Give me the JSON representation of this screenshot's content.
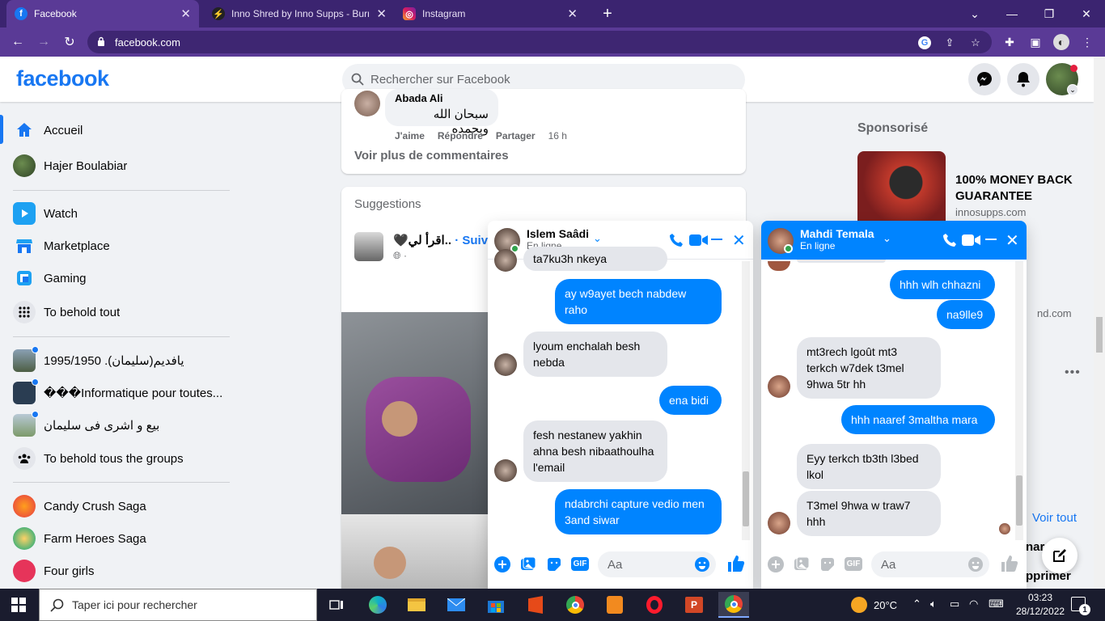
{
  "browser": {
    "tabs": [
      {
        "label": "Facebook",
        "active": true
      },
      {
        "label": "Inno Shred by Inno Supps - Burn",
        "active": false
      },
      {
        "label": "Instagram",
        "active": false
      }
    ],
    "url": "facebook.com"
  },
  "header": {
    "logo": "facebook",
    "search_placeholder": "Rechercher sur Facebook"
  },
  "sidebar": {
    "items": [
      {
        "label": "Accueil"
      },
      {
        "label": "Hajer Boulabiar"
      },
      {
        "label": "Watch"
      },
      {
        "label": "Marketplace"
      },
      {
        "label": "Gaming"
      },
      {
        "label": "To behold tout"
      },
      {
        "label": "1995/1950 .(سليمان)يافديم"
      },
      {
        "label": "���Informatique pour toutes..."
      },
      {
        "label": "بيع و اشرى فى سليمان"
      },
      {
        "label": "To behold tous the groups"
      },
      {
        "label": "Candy Crush Saga"
      },
      {
        "label": "Farm Heroes Saga"
      },
      {
        "label": "Four girls"
      }
    ]
  },
  "feed": {
    "comment_author": "Abada Ali",
    "comment_text": "سبحان الله وبحمده",
    "comment_actions": {
      "like": "J'aime",
      "reply": "Répondre",
      "share": "Partager",
      "time": "16 h"
    },
    "more_comments": "Voir plus de commentaires",
    "suggestions_title": "Suggestions",
    "suggestion_name": "..اقرأ لي🖤",
    "suggestion_follow": "· Suivre",
    "suggestion_privacy": "·"
  },
  "right": {
    "sponsored_title": "Sponsorisé",
    "ad_title": "100% MONEY BACK GUARANTEE",
    "ad_domain": "innosupps.com",
    "ad2_domain_partial": "nd.com",
    "see_all": "Voir tout",
    "partial1": "nar",
    "partial2": "pprimer"
  },
  "chat1": {
    "name": "Islem Saâdi",
    "status": "En ligne",
    "messages": [
      {
        "dir": "in",
        "text": "ta7ku3h nkeya"
      },
      {
        "dir": "out",
        "text": "ay w9ayet bech nabdew raho"
      },
      {
        "dir": "in",
        "text": "lyoum enchalah besh nebda"
      },
      {
        "dir": "out",
        "text": "ena bidi"
      },
      {
        "dir": "in",
        "text": "fesh nestanew yakhin ahna besh nibaathoulha l'email"
      },
      {
        "dir": "out",
        "text": "ndabrchi capture vedio men 3and siwar"
      }
    ],
    "input_placeholder": "Aa"
  },
  "chat2": {
    "name": "Mahdi Temala",
    "status": "En ligne",
    "messages": [
      {
        "dir": "out",
        "text": "hhh wlh chhazni"
      },
      {
        "dir": "out",
        "text": "na9lle9"
      },
      {
        "dir": "in",
        "text": "mt3rech lgoût mt3 terkch w7dek t3mel 9hwa 5tr hh"
      },
      {
        "dir": "out",
        "text": "hhh naaref 3maltha mara"
      },
      {
        "dir": "in",
        "text": "Eyy terkch tb3th l3bed lkol"
      },
      {
        "dir": "in",
        "text": "T3mel 9hwa w traw7 hhh"
      }
    ],
    "input_placeholder": "Aa"
  },
  "taskbar": {
    "search_placeholder": "Taper ici pour rechercher",
    "weather": "20°C",
    "time": "03:23",
    "date": "28/12/2022",
    "notifications": "1"
  },
  "colors": {
    "fb_blue": "#1877f2",
    "messenger_blue": "#0084ff",
    "chrome_purple": "#5a3a96"
  }
}
